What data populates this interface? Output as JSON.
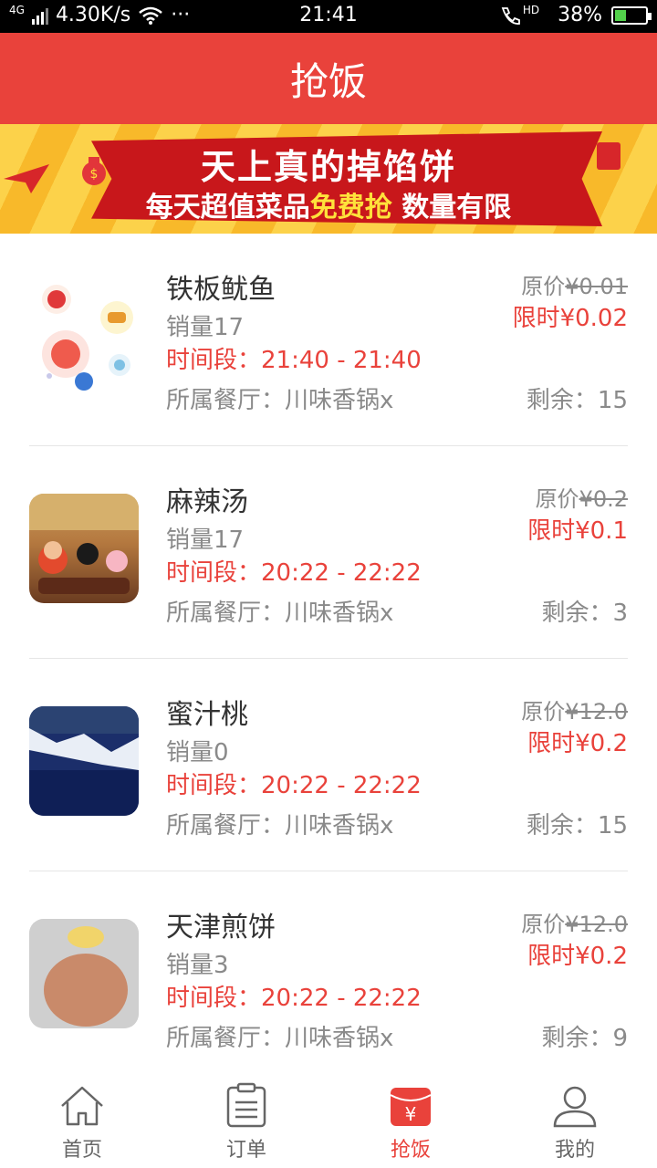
{
  "status": {
    "network": "4G",
    "speed": "4.30K/s",
    "time": "21:41",
    "hd": "HD",
    "battery": "38%",
    "battery_level": 0.38
  },
  "header": {
    "title": "抢饭"
  },
  "banner": {
    "line1": "天上真的掉馅饼",
    "line2_part1": "每天超值菜品",
    "line2_highlight": "免费抢",
    "line2_part2": " 数量有限"
  },
  "items": [
    {
      "name": "铁板鱿鱼",
      "sales": "销量17",
      "time": "时间段：21:40 - 21:40",
      "restaurant": "所属餐厅：川味香锅x",
      "original_label": "原价",
      "original_price": "¥0.01",
      "limit_price": "限时¥0.02",
      "remaining": "剩余：15"
    },
    {
      "name": "麻辣汤",
      "sales": "销量17",
      "time": "时间段：20:22 - 22:22",
      "restaurant": "所属餐厅：川味香锅x",
      "original_label": "原价",
      "original_price": "¥0.2",
      "limit_price": "限时¥0.1",
      "remaining": "剩余：3"
    },
    {
      "name": "蜜汁桃",
      "sales": "销量0",
      "time": "时间段：20:22 - 22:22",
      "restaurant": "所属餐厅：川味香锅x",
      "original_label": "原价",
      "original_price": "¥12.0",
      "limit_price": "限时¥0.2",
      "remaining": "剩余：15"
    },
    {
      "name": "天津煎饼",
      "sales": "销量3",
      "time": "时间段：20:22 - 22:22",
      "restaurant": "所属餐厅：川味香锅x",
      "original_label": "原价",
      "original_price": "¥12.0",
      "limit_price": "限时¥0.2",
      "remaining": "剩余：9"
    }
  ],
  "tabs": [
    {
      "label": "首页",
      "icon": "home-icon"
    },
    {
      "label": "订单",
      "icon": "order-icon"
    },
    {
      "label": "抢饭",
      "icon": "grab-food-icon",
      "active": true
    },
    {
      "label": "我的",
      "icon": "profile-icon"
    }
  ],
  "colors": {
    "accent": "#e9423b",
    "text_gray": "#8a8a8a"
  }
}
